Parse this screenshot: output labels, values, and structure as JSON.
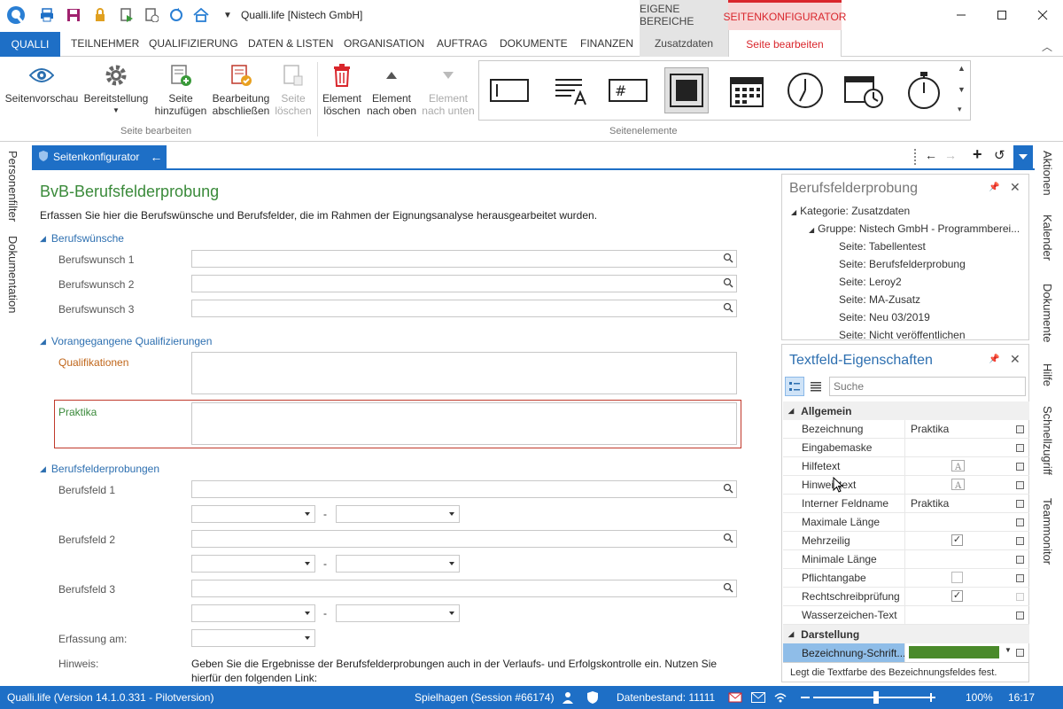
{
  "titlebar": {
    "app_title": "Qualli.life [Nistech GmbH]",
    "ctx_eigene": "EIGENE BEREICHE",
    "ctx_seiten": "SEITENKONFIGURATOR"
  },
  "menu": {
    "qualli": "QUALLI",
    "items": [
      "TEILNEHMER",
      "QUALIFIZIERUNG",
      "DATEN & LISTEN",
      "ORGANISATION",
      "AUFTRAG",
      "DOKUMENTE",
      "FINANZEN"
    ],
    "ctx_tab1": "Zusatzdaten",
    "ctx_tab2": "Seite bearbeiten"
  },
  "ribbon": {
    "btn_vorschau": "Seitenvorschau",
    "btn_bereitstellung": "Bereitstellung",
    "btn_add_1": "Seite",
    "btn_add_2": "hinzufügen",
    "btn_finish_1": "Bearbeitung",
    "btn_finish_2": "abschließen",
    "btn_del_page_1": "Seite",
    "btn_del_page_2": "löschen",
    "btn_del_el_1": "Element",
    "btn_del_el_2": "löschen",
    "btn_up_1": "Element",
    "btn_up_2": "nach oben",
    "btn_down_1": "Element",
    "btn_down_2": "nach unten",
    "group1": "Seite bearbeiten",
    "group2": "Seitenelemente"
  },
  "rails": {
    "left1": "Personenfilter",
    "left2": "Dokumentation",
    "right": [
      "Aktionen",
      "Kalender",
      "Dokumente",
      "Hilfe",
      "Schnellzugriff",
      "Teammonitor"
    ]
  },
  "doc": {
    "tab_label": "Seitenkonfigurator"
  },
  "form": {
    "title": "BvB-Berufsfelderprobung",
    "description": "Erfassen Sie hier die Berufswünsche und Berufsfelder, die im Rahmen der Eignungsanalyse herausgearbeitet wurden.",
    "sec1": "Berufswünsche",
    "bw1": "Berufswunsch 1",
    "bw2": "Berufswunsch 2",
    "bw3": "Berufswunsch 3",
    "sec2": "Vorangegangene Qualifizierungen",
    "qual": "Qualifikationen",
    "prak": "Praktika",
    "sec3": "Berufsfelderprobungen",
    "bf1": "Berufsfeld 1",
    "bf2": "Berufsfeld 2",
    "bf3": "Berufsfeld 3",
    "dash": "-",
    "erfassung": "Erfassung am:",
    "hinweis_label": "Hinweis:",
    "hinweis_1": "Geben Sie die Ergebnisse der Berufsfelderprobungen auch in der Verlaufs- und Erfolgskontrolle ein. Nutzen Sie",
    "hinweis_2": "hierfür den folgenden Link:"
  },
  "tree_panel": {
    "title": "Berufsfelderprobung",
    "kategorie": "Kategorie: Zusatzdaten",
    "gruppe": "Gruppe: Nistech GmbH - Programmberei...",
    "pages": [
      "Seite: Tabellentest",
      "Seite: Berufsfelderprobung",
      "Seite: Leroy2",
      "Seite: MA-Zusatz",
      "Seite: Neu 03/2019",
      "Seite: Nicht veröffentlichen"
    ]
  },
  "props_panel": {
    "title": "Textfeld-Eigenschaften",
    "search_placeholder": "Suche",
    "cat_allgemein": "Allgemein",
    "cat_darstellung": "Darstellung",
    "rows": [
      {
        "name": "Bezeichnung",
        "value": "Praktika"
      },
      {
        "name": "Eingabemaske",
        "value": ""
      },
      {
        "name": "Hilfetext",
        "value": ""
      },
      {
        "name": "Hinweistext",
        "value": ""
      },
      {
        "name": "Interner Feldname",
        "value": "Praktika"
      },
      {
        "name": "Maximale Länge",
        "value": ""
      },
      {
        "name": "Mehrzeilig",
        "value": ""
      },
      {
        "name": "Minimale Länge",
        "value": ""
      },
      {
        "name": "Pflichtangabe",
        "value": ""
      },
      {
        "name": "Rechtschreibprüfung",
        "value": ""
      },
      {
        "name": "Wasserzeichen-Text",
        "value": ""
      }
    ],
    "darst_row": "Bezeichnung-Schrift...",
    "darst_color": "#4a8a2a",
    "footer": "Legt die Textfarbe des Bezeichnungsfeldes fest."
  },
  "status": {
    "version": "Qualli.life (Version 14.1.0.331 - Pilotversion)",
    "user": "Spielhagen (Session #66174)",
    "datenbestand": "Datenbestand: 11111",
    "zoom": "100%",
    "time": "16:17"
  },
  "colors": {
    "accent": "#1e6fc6",
    "title_green": "#3a8a3a",
    "section_blue": "#2d6fb0",
    "selected_red": "#c0392b",
    "ctx_red": "#d9262c"
  }
}
